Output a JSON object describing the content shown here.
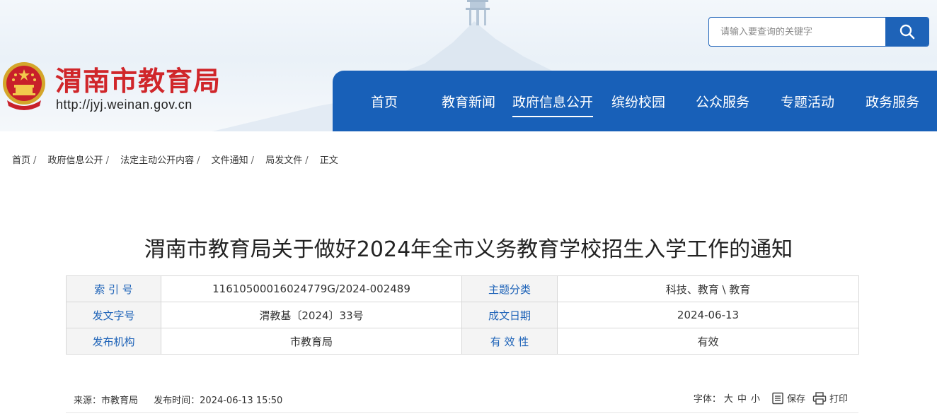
{
  "header": {
    "site_name": "渭南市教育局",
    "site_url": "http://jyj.weinan.gov.cn",
    "search_placeholder": "请输入要查询的关键字",
    "nav": [
      "首页",
      "教育新闻",
      "政府信息公开",
      "缤纷校园",
      "公众服务",
      "专题活动",
      "政务服务"
    ],
    "active_nav": "政府信息公开"
  },
  "breadcrumb": [
    "首页",
    "政府信息公开",
    "法定主动公开内容",
    "文件通知",
    "局发文件",
    "正文"
  ],
  "article": {
    "title": "渭南市教育局关于做好2024年全市义务教育学校招生入学工作的通知",
    "info": [
      {
        "label": "索 引 号",
        "value": "11610500016024779G/2024-002489",
        "label2": "主题分类",
        "value2": "科技、教育 \\ 教育"
      },
      {
        "label": "发文字号",
        "value": "渭教基〔2024〕33号",
        "label2": "成文日期",
        "value2": "2024-06-13"
      },
      {
        "label": "发布机构",
        "value": "市教育局",
        "label2": "有 效 性",
        "value2": "有效"
      }
    ],
    "source": "来源：市教育局",
    "publish_time": "发布时间：2024-06-13 15:50",
    "font_label": "字体：",
    "font_sizes": [
      "大",
      "中",
      "小"
    ],
    "save_label": "保存",
    "print_label": "打印"
  },
  "colors": {
    "brand_blue": "#1860b8",
    "brand_red": "#d0262a"
  }
}
